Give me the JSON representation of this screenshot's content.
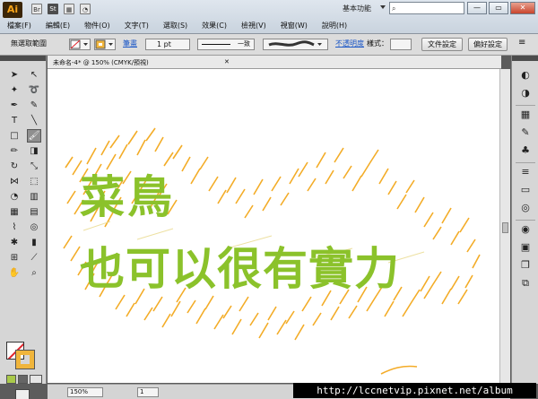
{
  "app": {
    "logo": "Ai",
    "top_icons": [
      "Br",
      "St"
    ],
    "workspace": "基本功能",
    "search_placeholder": "",
    "window_buttons": [
      "—",
      "▭",
      "✕"
    ]
  },
  "menu": [
    "檔案(F)",
    "編輯(E)",
    "物件(O)",
    "文字(T)",
    "選取(S)",
    "效果(C)",
    "檢視(V)",
    "視窗(W)",
    "說明(H)"
  ],
  "control_bar": {
    "selection_state": "無選取範圍",
    "stroke_label": "筆畫",
    "stroke_weight": "1 pt",
    "stroke_profile": "一致",
    "brush_label": "",
    "opacity_label": "不透明度",
    "style_label": "樣式：",
    "document_setup": "文件設定",
    "preferences": "偏好設定"
  },
  "document": {
    "tab_title": "未命名-4* @ 150% (CMYK/預視)",
    "close": "✕",
    "zoom": "150%",
    "page": "1"
  },
  "artwork": {
    "line1": "菜鳥",
    "line2": "也可以很有實力",
    "text_color": "#8bc22b",
    "scribble_color": "#f3a81c"
  },
  "watermark": "http://lccnetvip.pixnet.net/album"
}
